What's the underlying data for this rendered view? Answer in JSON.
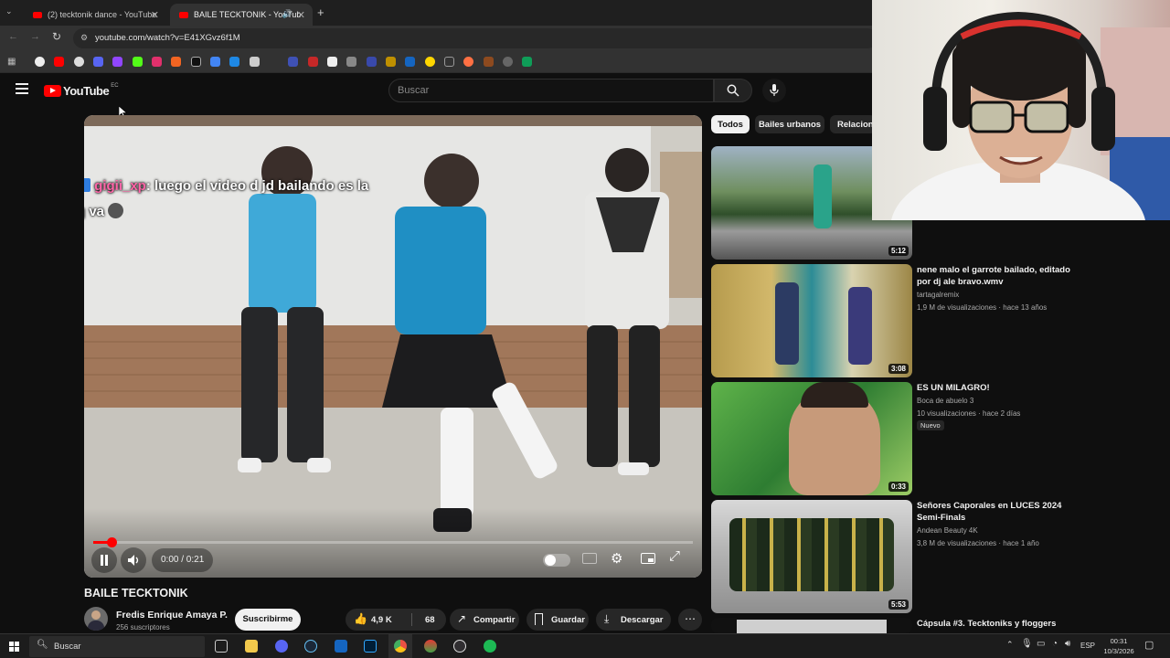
{
  "browser": {
    "tabs": [
      {
        "title": "(2) tecktonik dance - YouTube"
      },
      {
        "title": "BAILE TECKTONIK - YouTub"
      }
    ],
    "url": "youtube.com/watch?v=E41XGvz6f1M"
  },
  "youtube": {
    "logo_text": "YouTube",
    "region": "EC",
    "search_placeholder": "Buscar"
  },
  "player": {
    "chat_user": "gigii_xp",
    "chat_message": ": luego el video d jd bailando es la",
    "chat_message_line2": "q va",
    "time": "0:00 / 0:21",
    "progress": 0.03
  },
  "video": {
    "title": "BAILE TECKTONIK",
    "channel": "Fredis Enrique Amaya P.",
    "subscribers": "256 suscriptores",
    "subscribe_label": "Suscribirme",
    "likes": "4,9 K",
    "comments": "68",
    "share_label": "Compartir",
    "save_label": "Guardar",
    "download_label": "Descargar"
  },
  "chips": [
    "Todos",
    "Bailes urbanos",
    "Relacion"
  ],
  "related": [
    {
      "duration": "5:12",
      "title": "",
      "channel": "",
      "meta": ""
    },
    {
      "duration": "3:08",
      "title": "nene malo el garrote bailado, editado por dj ale bravo.wmv",
      "channel": "tartagalremix",
      "meta": "1,9 M de visualizaciones · hace 13 años"
    },
    {
      "duration": "0:33",
      "title": "ES UN MILAGRO!",
      "channel": "Boca de abuelo 3",
      "meta": "10 visualizaciones · hace 2 días",
      "badge": "Nuevo"
    },
    {
      "duration": "5:53",
      "title": "Señores Caporales en LUCES 2024 Semi-Finals",
      "channel": "Andean Beauty 4K",
      "meta": "3,8 M de visualizaciones · hace 1 año"
    },
    {
      "duration": "",
      "title": "Cápsula #3. Tecktoniks y floggers",
      "channel": "",
      "meta": ""
    }
  ],
  "taskbar": {
    "search_placeholder": "Buscar",
    "lang": "ESP",
    "time": "00:31",
    "date": "10/3/2026"
  },
  "colors": {
    "accent_red": "#ff0000",
    "background": "#0f0f0f",
    "chip_active": "#f1f1f1"
  }
}
